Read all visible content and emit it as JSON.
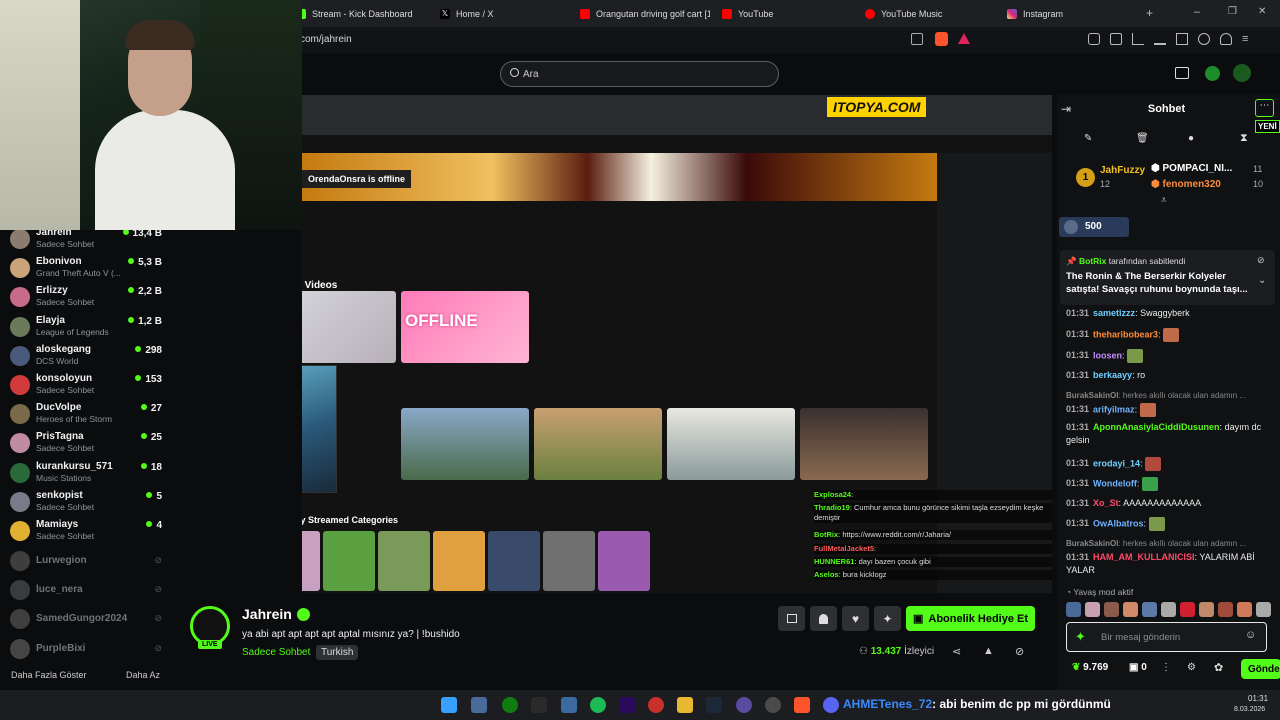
{
  "tabs": [
    {
      "label": "Stream - Kick Dashboard",
      "color": "#53fc18"
    },
    {
      "label": "Home / X",
      "color": "#ffffff"
    },
    {
      "label": "Orangutan driving golf cart [1(",
      "color": "#ff0000"
    },
    {
      "label": "YouTube",
      "color": "#ff0000"
    },
    {
      "label": "YouTube Music",
      "color": "#ff0000"
    },
    {
      "label": "Instagram",
      "color": "#d6249f"
    }
  ],
  "window": {
    "new_tab": "+",
    "minimize": "–",
    "maximize": "❐",
    "close": "✕"
  },
  "address": {
    "url": "com/jahrein"
  },
  "search": {
    "placeholder": "Ara"
  },
  "sidebar": {
    "channels": [
      {
        "name": "Jahrein",
        "sub": "Sadece Sohbet",
        "viewers": "13,4 B",
        "color": "#8a7d70"
      },
      {
        "name": "Ebonivon",
        "sub": "Grand Theft Auto V (...",
        "viewers": "5,3 B",
        "color": "#c9a37a"
      },
      {
        "name": "Erlizzy",
        "sub": "Sadece Sohbet",
        "viewers": "2,2 B",
        "color": "#c86a8a"
      },
      {
        "name": "Elayja",
        "sub": "League of Legends",
        "viewers": "1,2 B",
        "color": "#6a7a5a"
      },
      {
        "name": "aloskegang",
        "sub": "DCS World",
        "viewers": "298",
        "color": "#4a5a7a"
      },
      {
        "name": "konsoloyun",
        "sub": "Sadece Sohbet",
        "viewers": "153",
        "color": "#d23b3b"
      },
      {
        "name": "DucVolpe",
        "sub": "Heroes of the Storm",
        "viewers": "27",
        "color": "#7a6a4a"
      },
      {
        "name": "PrisTagna",
        "sub": "Sadece Sohbet",
        "viewers": "25",
        "color": "#c08aa0"
      },
      {
        "name": "kurankursu_571",
        "sub": "Music Stations",
        "viewers": "18",
        "color": "#2a6a3a"
      },
      {
        "name": "senkopist",
        "sub": "Sadece Sohbet",
        "viewers": "5",
        "color": "#7a7a8a"
      },
      {
        "name": "Mamiays",
        "sub": "Sadece Sohbet",
        "viewers": "4",
        "color": "#e0b030"
      }
    ],
    "offline": [
      {
        "name": "Lurwegion",
        "color": "#5a6a7a"
      },
      {
        "name": "luce_nera",
        "color": "#7a5a6a"
      },
      {
        "name": "SamedGungor2024",
        "color": "#6a6a6a"
      },
      {
        "name": "PurpleBixi",
        "color": "#8a6aa0"
      }
    ],
    "show_more": "Daha Fazla Göster",
    "show_less": "Daha Az"
  },
  "shared": {
    "offline_banner": "OrendaOnsra is offline",
    "logo": "ITOPYA.COM",
    "section_videos": "Stream Videos",
    "section_recent": "Recently Streamed Categories",
    "offline_thumb": "OFFLINE",
    "chat_lines": [
      {
        "user": "Explosa24",
        "text": "",
        "color": "#53fc18"
      },
      {
        "user": "Thradio19",
        "text": "Cumhur amca bunu görünce sikimi taşla ezseydim keşke demiştir",
        "color": "#53fc18"
      },
      {
        "user": "BotRix",
        "text": "https://www.reddit.com/r/Jaharia/",
        "color": "#53fc18"
      },
      {
        "user": "FullMetalJacket5",
        "text": "",
        "color": "#ff5a5a"
      },
      {
        "user": "HUNNER61",
        "text": "dayı bazen çocuk gibi",
        "color": "#53fc18"
      },
      {
        "user": "Aselos",
        "text": "bura kicklogz",
        "color": "#53fc18"
      }
    ]
  },
  "streamer": {
    "name": "Jahrein",
    "live": "LIVE",
    "title": "ya abi apt apt apt apt aptal mısınız ya? | !bushido",
    "category": "Sadece Sohbet",
    "language": "Turkish",
    "viewers": "13.437",
    "viewers_label": "İzleyici",
    "gift_button": "Abonelik Hediye Et"
  },
  "chat": {
    "header": "Sohbet",
    "new_badge": "YENİ",
    "top": [
      {
        "rank": "1",
        "name": "JahFuzzy",
        "count": "12"
      },
      {
        "rank": "",
        "name": "POMPACI_NI...",
        "count": "11"
      },
      {
        "rank": "",
        "name": "fenomen320",
        "count": "10"
      }
    ],
    "points": "500",
    "pinned_by": "BotRix",
    "pinned_label": "tarafından sabitlendi",
    "pinned_text": "The Ronin & The Berserkir Kolyeler satışta! Savaşçı ruhunu boynunda taşı...",
    "messages": [
      {
        "time": "01:31",
        "user": "sametizzz",
        "text": "Swaggyberk",
        "color": "#6fd0ff"
      },
      {
        "time": "01:31",
        "user": "theharibobear3",
        "text": "",
        "color": "#ff8c3a"
      },
      {
        "time": "01:31",
        "user": "loosen",
        "text": "",
        "color": "#c38cff"
      },
      {
        "time": "01:31",
        "user": "berkaayy",
        "text": "ro",
        "color": "#6fd0ff"
      },
      {
        "time": "",
        "user": "BurakSakinOl",
        "text": "herkes akıllı olacak ulan adamın ...",
        "color": "#888888"
      },
      {
        "time": "01:31",
        "user": "arifyilmaz",
        "text": "",
        "color": "#6fb2ff"
      },
      {
        "time": "01:31",
        "user": "AponnAnasiylaCiddiDusunen",
        "text": "dayım dc gelsin",
        "color": "#53fc18"
      },
      {
        "time": "01:31",
        "user": "erodayi_14",
        "text": "",
        "color": "#6fd0ff"
      },
      {
        "time": "01:31",
        "user": "Wondeloff",
        "text": "",
        "color": "#6fb2ff"
      },
      {
        "time": "01:31",
        "user": "Xo_St",
        "text": "AAAAAAAAAAAAA",
        "color": "#ff4a6a"
      },
      {
        "time": "01:31",
        "user": "OwAlbatros",
        "text": "",
        "color": "#6fb2ff"
      },
      {
        "time": "",
        "user": "BurakSakinOl",
        "text": "herkes akıllı olacak ulan adamın ...",
        "color": "#888888"
      },
      {
        "time": "01:31",
        "user": "HAM_AM_KULLANICISI",
        "text": "YALARIM ABİ YALAR",
        "color": "#ff4a6a"
      }
    ],
    "slow_mode": "Yavaş mod aktif",
    "input_placeholder": "Bir mesaj gönderin",
    "points_balance": "9.769",
    "gifts": "0",
    "send": "Gönder"
  },
  "taskbar": {
    "notification_user": "AHMETenes_72",
    "notification_text": ": abi benim dc pp mi gördünmü",
    "time": "01:31",
    "date": "8.03.2026"
  }
}
